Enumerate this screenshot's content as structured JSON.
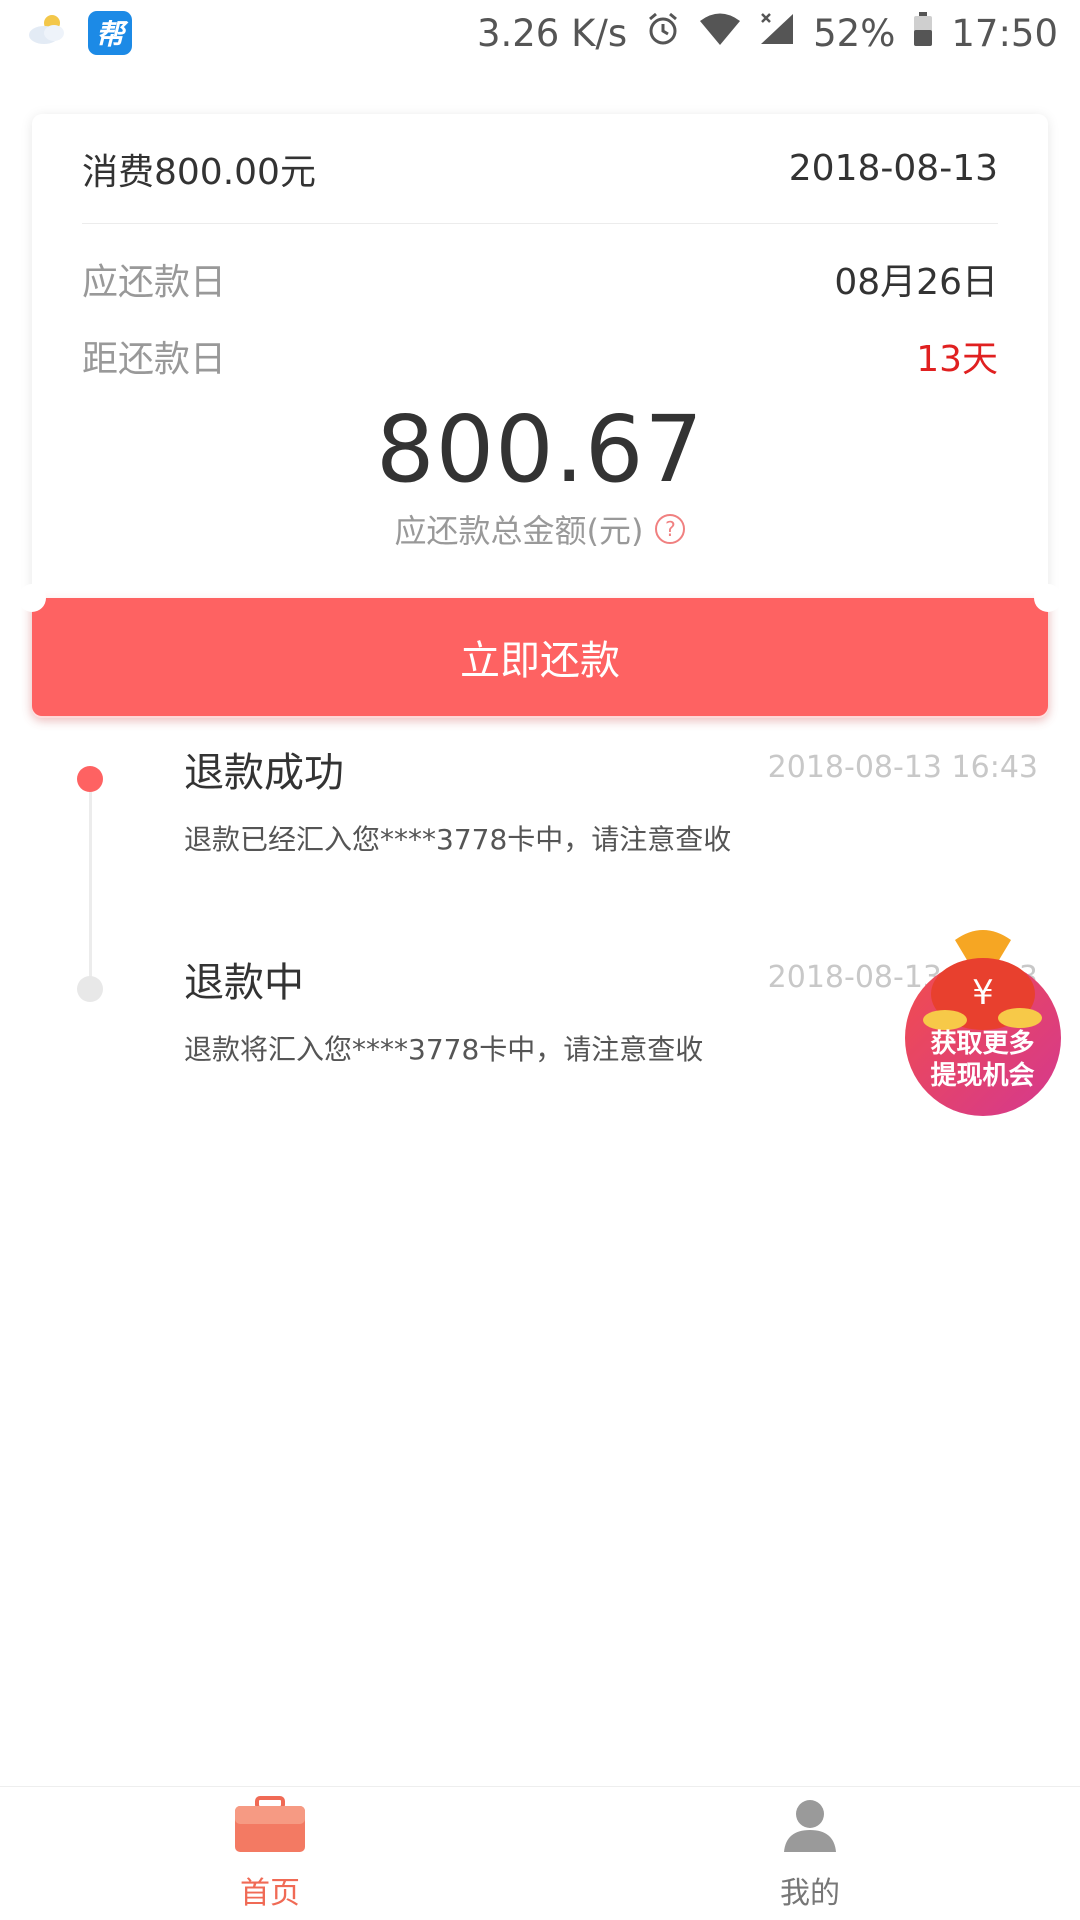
{
  "status_bar": {
    "speed": "3.26 K/s",
    "battery": "52%",
    "time": "17:50",
    "app_icon_glyph": "帮"
  },
  "card": {
    "title": "消费800.00元",
    "date": "2018-08-13",
    "due_label": "应还款日",
    "due_value": "08月26日",
    "remaining_label": "距还款日",
    "remaining_value": "13天",
    "amount": "800.67",
    "amount_caption": "应还款总金额(元)",
    "help_glyph": "?"
  },
  "repay_button_label": "立即还款",
  "timeline": [
    {
      "title": "退款成功",
      "time": "2018-08-13 16:43",
      "description": "退款已经汇入您****3778卡中，请注意查收",
      "dot_color": "#fe6262"
    },
    {
      "title": "退款中",
      "time": "2018-08-13 16:43",
      "description": "退款将汇入您****3778卡中，请注意查收",
      "dot_color": "#e8e8e8"
    }
  ],
  "promo": {
    "symbol": "¥",
    "line1": "获取更多",
    "line2": "提现机会"
  },
  "tabs": [
    {
      "label": "首页",
      "icon": "briefcase-icon",
      "active": true
    },
    {
      "label": "我的",
      "icon": "user-icon",
      "active": false
    }
  ],
  "colors": {
    "accent": "#fe6262",
    "alert_red": "#e02020",
    "active_tab": "#f06a55"
  }
}
